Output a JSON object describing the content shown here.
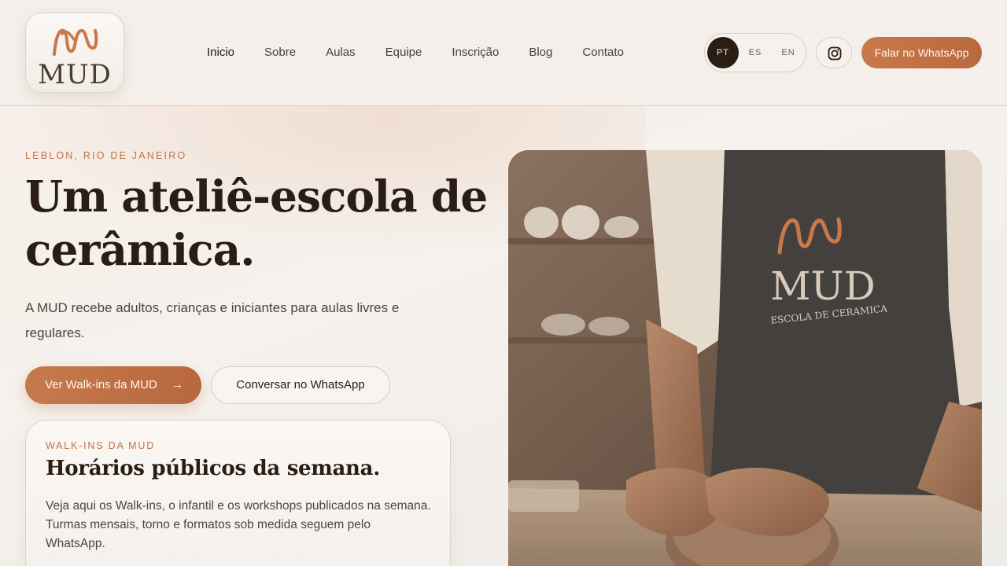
{
  "brand": {
    "logo_word": "MUD"
  },
  "nav": {
    "items": [
      "Inicio",
      "Sobre",
      "Aulas",
      "Equipe",
      "Inscrição",
      "Blog",
      "Contato"
    ]
  },
  "lang": {
    "options": [
      "PT",
      "ES",
      "EN"
    ],
    "active": "PT"
  },
  "header": {
    "whatsapp_label": "Falar no WhatsApp",
    "instagram_icon": "instagram-icon"
  },
  "hero": {
    "eyebrow": "LEBLON, RIO DE JANEIRO",
    "title_line1": "Um ateliê-escola de",
    "title_line2": "cerâmica.",
    "lead": "A MUD recebe adultos, crianças e iniciantes para aulas livres e regulares.",
    "primary_label": "Ver Walk-ins da MUD",
    "primary_icon": "→",
    "secondary_label": "Conversar no WhatsApp"
  },
  "card": {
    "kicker": "WALK-INS DA MUD",
    "heading": "Horários públicos da semana.",
    "body": "Veja aqui os Walk-ins, o infantil e os workshops publicados na semana. Turmas mensais, torno e formatos sob medida seguem pelo WhatsApp."
  },
  "photo": {
    "apron_word": "MUD",
    "apron_sub": "ESCOLA DE CERAMICA"
  },
  "colors": {
    "accent": "#c07347",
    "dark": "#2a1d14",
    "background": "#f5f1ec"
  }
}
